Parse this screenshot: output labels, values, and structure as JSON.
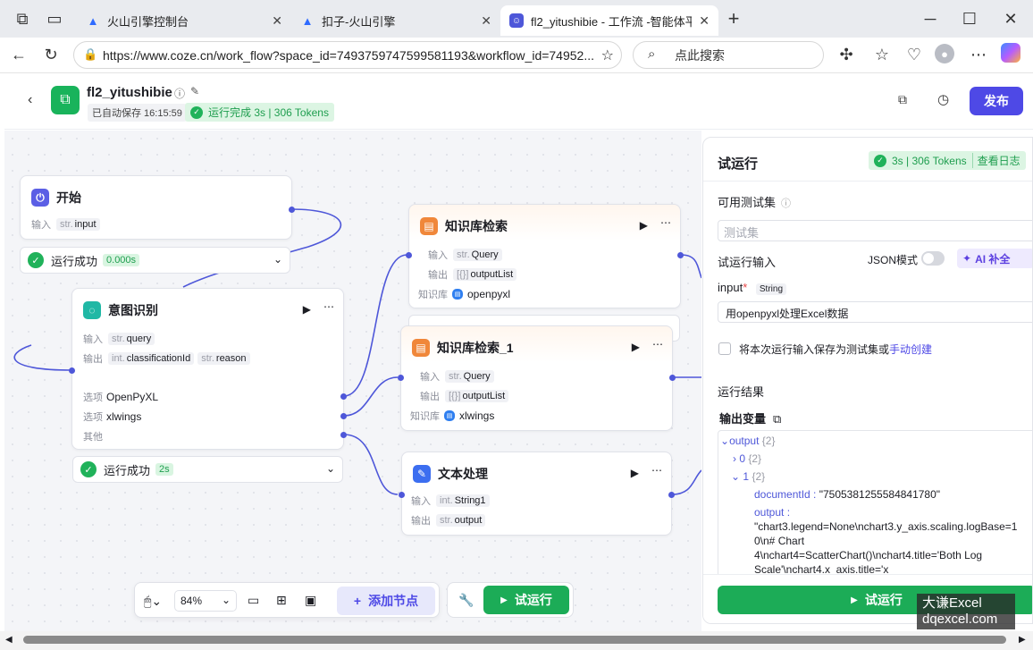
{
  "browser": {
    "tabs": [
      {
        "label": "火山引擎控制台"
      },
      {
        "label": "扣子-火山引擎"
      },
      {
        "label": "fl2_yitushibie - 工作流 -智能体平台"
      }
    ],
    "url": "https://www.coze.cn/work_flow?space_id=7493759747599581193&workflow_id=74952...",
    "search_placeholder": "点此搜索"
  },
  "header": {
    "title": "fl2_yitushibie",
    "autosave": "已自动保存 16:15:59",
    "run_status": "运行完成 3s | 306 Tokens",
    "publish_label": "发布"
  },
  "nodes": {
    "start": {
      "title": "开始",
      "input_label": "输入",
      "input_type": "str.",
      "input_name": "input",
      "status": "运行成功",
      "time": "0.000s"
    },
    "intent": {
      "title": "意图识别",
      "input_label": "输入",
      "input_type": "str.",
      "input_name": "query",
      "output_label": "输出",
      "out1_type": "int.",
      "out1_name": "classificationId",
      "out2_type": "str.",
      "out2_name": "reason",
      "opt_label": "选项",
      "opt1": "OpenPyXL",
      "opt2": "xlwings",
      "other": "其他",
      "status": "运行成功",
      "time": "2s"
    },
    "kb1": {
      "title": "知识库检索",
      "input_label": "输入",
      "input_type": "str.",
      "input_name": "Query",
      "output_label": "输出",
      "output_type": "[{}]",
      "output_name": "outputList",
      "kb_label": "知识库",
      "kb_name": "openpyxl"
    },
    "kb2": {
      "title": "知识库检索_1",
      "input_label": "输入",
      "input_type": "str.",
      "input_name": "Query",
      "output_label": "输出",
      "output_type": "[{}]",
      "output_name": "outputList",
      "kb_label": "知识库",
      "kb_name": "xlwings"
    },
    "text": {
      "title": "文本处理",
      "input_label": "输入",
      "input_type": "int.",
      "input_name": "String1",
      "output_label": "输出",
      "output_type": "str.",
      "output_name": "output"
    }
  },
  "bottom": {
    "zoom": "84%",
    "add_node": "添加节点",
    "test_run": "试运行"
  },
  "panel": {
    "title": "试运行",
    "stat": "3s | 306 Tokens",
    "view_log": "查看日志",
    "testset_label": "可用测试集",
    "testset_placeholder": "测试集",
    "input_title": "试运行输入",
    "json_mode": "JSON模式",
    "ai_fill": "AI 补全",
    "input_name": "input",
    "input_type": "String",
    "input_value": "用openpyxl处理Excel数据",
    "save_text": "将本次运行输入保存为测试集或",
    "manual_create": "手动创建",
    "result_title": "运行结果",
    "output_var": "输出变量",
    "tree": {
      "output": "output",
      "output_count": "{2}",
      "i0": "0",
      "i0_count": "{2}",
      "i1": "1",
      "i1_count": "{2}",
      "doc_key": "documentId :",
      "doc_val": "\"7505381255584841780\"",
      "out_key": "output :",
      "out_line1": "\"chart3.legend=None\\nchart3.y_axis.scaling.logBase=1",
      "out_line2": "0\\n# Chart",
      "out_line3": "4\\nchart4=ScatterChart()\\nchart4.title='Both Log",
      "out_line4": "Scale'\\nchart4.x_axis.title='x"
    },
    "run_button": "试运行"
  },
  "watermark": {
    "line1": "大谦Excel",
    "line2": "dqexcel.com"
  }
}
